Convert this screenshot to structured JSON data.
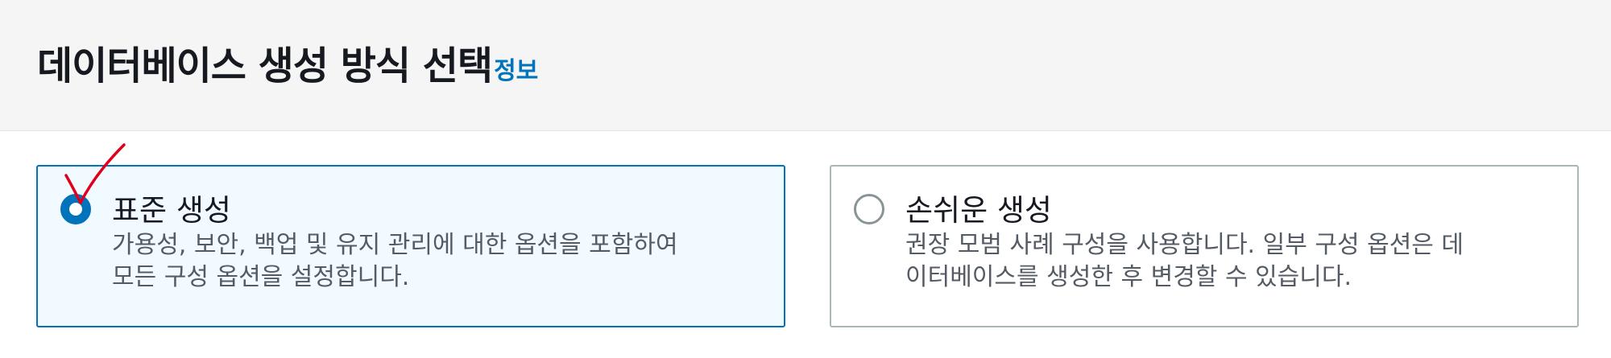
{
  "section": {
    "title": "데이터베이스 생성 방식 선택",
    "info_link": "정보"
  },
  "options": [
    {
      "label": "표준 생성",
      "description": "가용성, 보안, 백업 및 유지 관리에 대한 옵션을 포함하여\n모든 구성 옵션을 설정합니다.",
      "selected": true
    },
    {
      "label": "손쉬운 생성",
      "description": "권장 모범 사례 구성을 사용합니다. 일부 구성 옵션은 데\n이터베이스를 생성한 후 변경할 수 있습니다.",
      "selected": false
    }
  ],
  "colors": {
    "accent": "#0073bb",
    "selected_bg": "#f1faff",
    "annotation": "#e0001b"
  },
  "icons": {
    "annotation": "red-checkmark-icon"
  }
}
